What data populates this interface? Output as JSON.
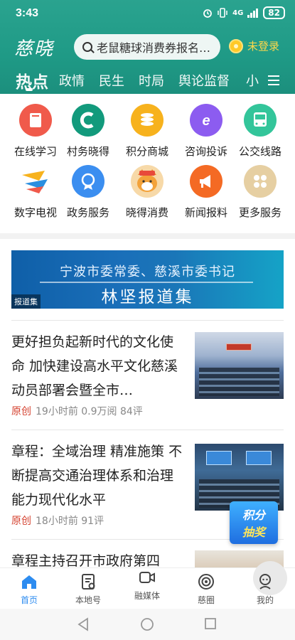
{
  "status_bar": {
    "time": "3:43",
    "network": "4G",
    "battery": "82"
  },
  "top_bar": {
    "logo": "慈晓",
    "search_placeholder": "老鼠糖球消费券报名…",
    "login_label": "未登录"
  },
  "tabs": [
    {
      "label": "热点",
      "active": true
    },
    {
      "label": "政情"
    },
    {
      "label": "民生"
    },
    {
      "label": "时局"
    },
    {
      "label": "舆论监督"
    },
    {
      "label": "小"
    }
  ],
  "services": [
    {
      "label": "在线学习",
      "icon": "book-icon",
      "color": "#f05a4b"
    },
    {
      "label": "村务晓得",
      "icon": "village-c-icon",
      "color": "#129a7c"
    },
    {
      "label": "积分商城",
      "icon": "coins-icon",
      "color": "#f7b21d"
    },
    {
      "label": "咨询投诉",
      "icon": "e-chat-icon",
      "color": "#8c5cf0"
    },
    {
      "label": "公交线路",
      "icon": "bus-icon",
      "color": "#33c59a"
    },
    {
      "label": "数字电视",
      "icon": "tv-logo-icon",
      "color": "#2a8fe0"
    },
    {
      "label": "政务服务",
      "icon": "medal-icon",
      "color": "#3b8ef0"
    },
    {
      "label": "晓得消费",
      "icon": "shiba-dog-icon",
      "color": "#f3a23a"
    },
    {
      "label": "新闻报料",
      "icon": "megaphone-icon",
      "color": "#f46a24"
    },
    {
      "label": "更多服务",
      "icon": "grid-more-icon",
      "color": "#e6cfa2"
    }
  ],
  "banner": {
    "line1": "宁波市委常委、慈溪市委书记",
    "line2": "林坚报道集",
    "tag": "报道集"
  },
  "news": [
    {
      "title": "更好担负起新时代的文化使命 加快建设高水平文化慈溪动员部署会暨全市…",
      "source": "原创",
      "meta": "19小时前 0.9万阅 84评"
    },
    {
      "title": "章程：全域治理 精准施策 不断提高交通治理体系和治理能力现代化水平",
      "source": "原创",
      "meta": "18小时前 91评"
    },
    {
      "title": "章程主持召开市政府第四",
      "source": "",
      "meta": ""
    }
  ],
  "floating_badge": {
    "line1": "积分",
    "line2": "抽奖"
  },
  "bottom_nav": [
    {
      "label": "首页",
      "active": true
    },
    {
      "label": "本地号"
    },
    {
      "label": "融媒体"
    },
    {
      "label": "慈圈"
    },
    {
      "label": "我的"
    }
  ]
}
